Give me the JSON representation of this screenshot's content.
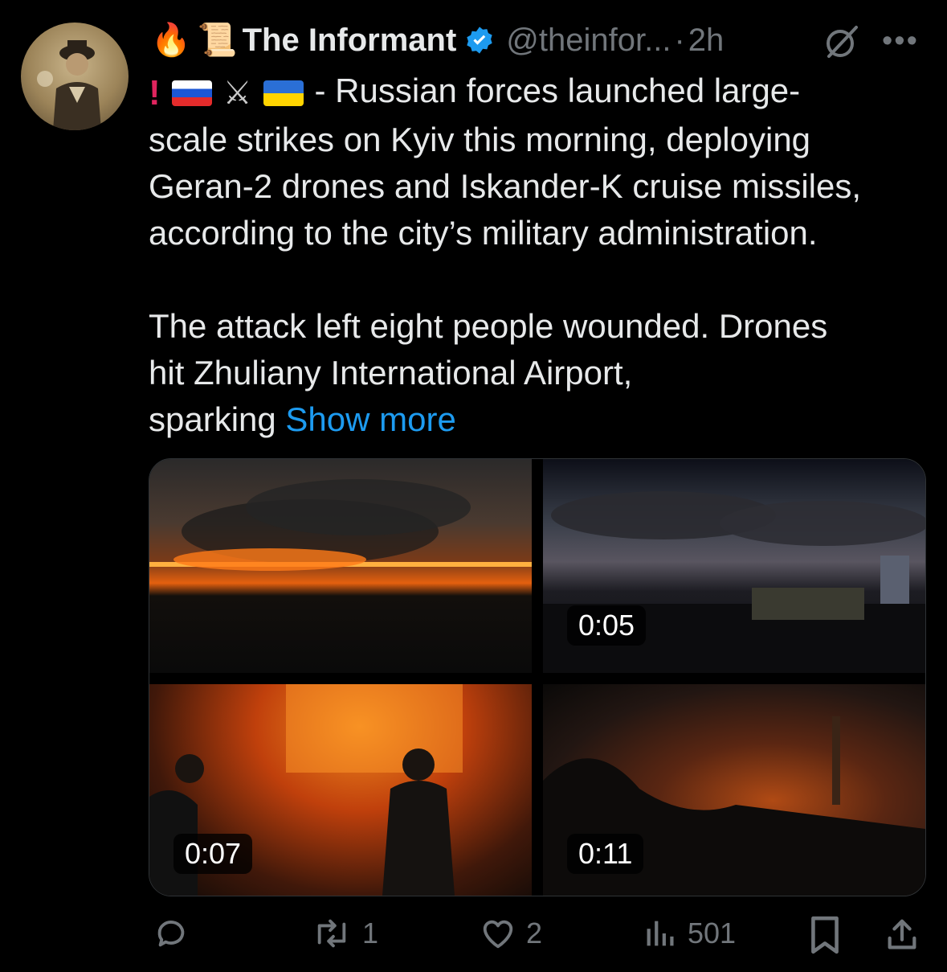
{
  "post": {
    "author_prefix_emojis": [
      "🔥",
      "📜"
    ],
    "author_name": "The Informant",
    "handle": "@theinfor...",
    "separator": "·",
    "time": "2h",
    "more_icon": "ellipsis-icon",
    "text_line1": "- Russian forces launched large-",
    "text_body": "scale strikes on Kyiv this morning, deploying\nGeran-2 drones and Iskander-K cruise missiles,\naccording to the city’s military administration.\n\nThe attack left eight people wounded. Drones\nhit Zhuliany International Airport,\nsparking ",
    "show_more": "Show more"
  },
  "media": [
    {
      "type": "image",
      "duration": ""
    },
    {
      "type": "video",
      "duration": "0:05"
    },
    {
      "type": "video",
      "duration": "0:07"
    },
    {
      "type": "video",
      "duration": "0:11"
    }
  ],
  "actions": {
    "reply_count": "",
    "repost_count": "1",
    "like_count": "2",
    "views_count": "501"
  },
  "colors": {
    "background": "#000000",
    "text": "#e7e9ea",
    "muted": "#71767b",
    "link": "#1d9bf0",
    "verified": "#1d9bf0"
  }
}
